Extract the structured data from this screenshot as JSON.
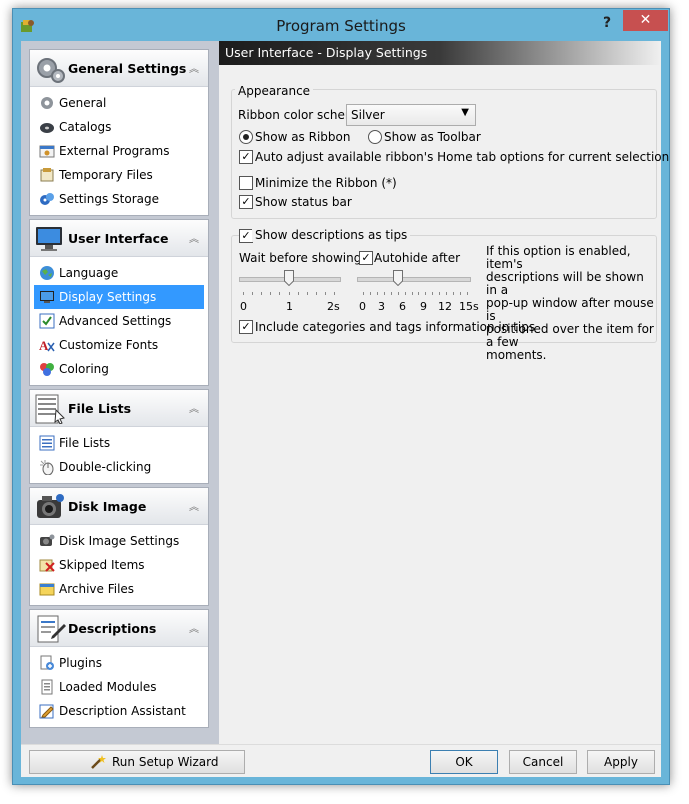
{
  "window": {
    "title": "Program Settings",
    "help": "?",
    "close": "✕"
  },
  "sidebar": {
    "groups": [
      {
        "title": "General Settings",
        "items": [
          "General",
          "Catalogs",
          "External Programs",
          "Temporary Files",
          "Settings Storage"
        ]
      },
      {
        "title": "User Interface",
        "items": [
          "Language",
          "Display Settings",
          "Advanced Settings",
          "Customize Fonts",
          "Coloring"
        ]
      },
      {
        "title": "File Lists",
        "items": [
          "File Lists",
          "Double-clicking"
        ]
      },
      {
        "title": "Disk Image",
        "items": [
          "Disk Image Settings",
          "Skipped Items",
          "Archive Files"
        ]
      },
      {
        "title": "Descriptions",
        "items": [
          "Plugins",
          "Loaded Modules",
          "Description Assistant"
        ]
      }
    ],
    "selected": "Display Settings",
    "collapse_glyph": "︽"
  },
  "main": {
    "header": "User Interface - Display Settings",
    "appearance": {
      "legend": "Appearance",
      "ribbon_label": "Ribbon color scheme:",
      "ribbon_value": "Silver",
      "show_ribbon": "Show as Ribbon",
      "show_toolbar": "Show as Toolbar",
      "auto_adjust": "Auto adjust available ribbon's Home tab options for current selection",
      "minimize_ribbon": "Minimize the Ribbon (*)",
      "show_status_bar": "Show status bar",
      "states": {
        "show_ribbon": true,
        "show_toolbar": false,
        "auto_adjust": true,
        "minimize_ribbon": false,
        "show_status_bar": true
      }
    },
    "tips": {
      "legend": "Show descriptions as tips",
      "wait_label": "Wait before showing",
      "autohide_label": "Autohide after",
      "wait_ticks": [
        "0",
        "1",
        "2s"
      ],
      "autohide_ticks": [
        "0",
        "3",
        "6",
        "9",
        "12",
        "15s"
      ],
      "wait_value": 1.0,
      "autohide_value": 5.0,
      "info": [
        "If this option is enabled, item's",
        "descriptions will be shown in a",
        "pop-up window after mouse is",
        "positioned over the item for a few",
        "moments."
      ],
      "include_categories": "Include categories and tags information in tips",
      "states": {
        "show_tips": true,
        "autohide": true,
        "include_categories": true
      }
    }
  },
  "footer": {
    "wizard": "Run Setup Wizard",
    "ok": "OK",
    "cancel": "Cancel",
    "apply": "Apply"
  }
}
